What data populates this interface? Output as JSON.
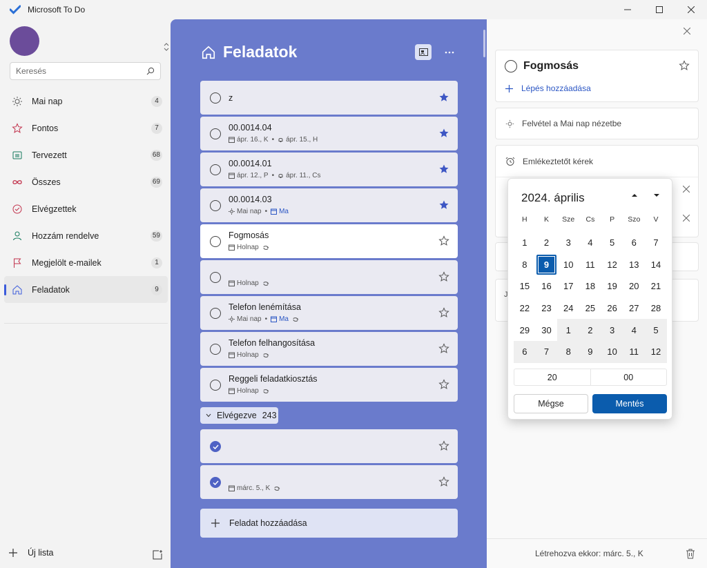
{
  "window": {
    "title": "Microsoft To Do"
  },
  "sidebar": {
    "search_placeholder": "Keresés",
    "items": [
      {
        "label": "Mai nap",
        "count": "4",
        "icon": "sun-icon"
      },
      {
        "label": "Fontos",
        "count": "7",
        "icon": "star-icon"
      },
      {
        "label": "Tervezett",
        "count": "68",
        "icon": "calendar-grid-icon"
      },
      {
        "label": "Összes",
        "count": "69",
        "icon": "infinity-icon"
      },
      {
        "label": "Elvégzettek",
        "count": "",
        "icon": "check-circle-icon"
      },
      {
        "label": "Hozzám rendelve",
        "count": "59",
        "icon": "person-icon"
      },
      {
        "label": "Megjelölt e-mailek",
        "count": "1",
        "icon": "flag-icon"
      },
      {
        "label": "Feladatok",
        "count": "9",
        "icon": "home-icon"
      }
    ],
    "new_list": "Új lista"
  },
  "main": {
    "title": "Feladatok",
    "tasks": [
      {
        "name": "z"
      },
      {
        "name": "00.0014.04",
        "due": "ápr. 16., K",
        "reminder": "ápr. 15., H"
      },
      {
        "name": "00.0014.01",
        "due": "ápr. 12., P",
        "reminder": "ápr. 11., Cs"
      },
      {
        "name": "00.0014.03",
        "myday": "Mai nap",
        "due": "Ma"
      },
      {
        "name": "Fogmosás",
        "due": "Holnap"
      },
      {
        "name": "",
        "due": "Holnap"
      },
      {
        "name": "Telefon lenémítása",
        "myday": "Mai nap",
        "due": "Ma"
      },
      {
        "name": "Telefon felhangosítása",
        "due": "Holnap"
      },
      {
        "name": "Reggeli feladatkiosztás",
        "due": "Holnap"
      }
    ],
    "completed_label": "Elvégezve",
    "completed_count": "243",
    "completed_tasks": [
      {
        "name": ""
      },
      {
        "name": "",
        "due": "márc. 5., K"
      }
    ],
    "add_task": "Feladat hozzáadása"
  },
  "detail": {
    "task_title": "Fogmosás",
    "add_step": "Lépés hozzáadása",
    "add_to_myday": "Felvétel a Mai nap nézetbe",
    "remind_me": "Emlékeztetőt kérek",
    "note_initial": "J",
    "created": "Létrehozva ekkor: márc. 5., K"
  },
  "datepicker": {
    "month": "2024. április",
    "weekdays": [
      "H",
      "K",
      "Sze",
      "Cs",
      "P",
      "Szo",
      "V"
    ],
    "days": [
      "1",
      "2",
      "3",
      "4",
      "5",
      "6",
      "7",
      "8",
      "9",
      "10",
      "11",
      "12",
      "13",
      "14",
      "15",
      "16",
      "17",
      "18",
      "19",
      "20",
      "21",
      "22",
      "23",
      "24",
      "25",
      "26",
      "27",
      "28",
      "29",
      "30",
      "1",
      "2",
      "3",
      "4",
      "5",
      "6",
      "7",
      "8",
      "9",
      "10",
      "11",
      "12"
    ],
    "selected_day": "9",
    "hour": "20",
    "minute": "00",
    "cancel": "Mégse",
    "save": "Mentés"
  },
  "colors": {
    "main_bg": "#6a7bcc",
    "accent": "#0b5cad",
    "star": "#3d56c4"
  }
}
